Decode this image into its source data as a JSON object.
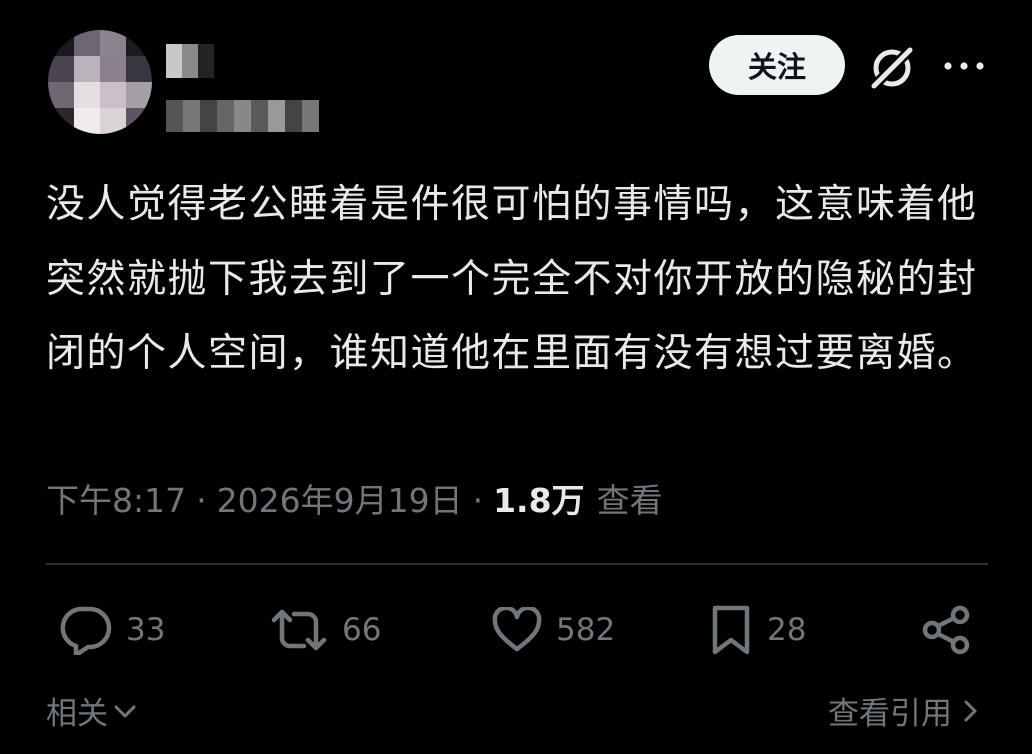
{
  "header": {
    "follow_label": "关注",
    "grok_icon": "grok-icon",
    "more_icon": "more-icon"
  },
  "post": {
    "text": "没人觉得老公睡着是件很可怕的事情吗，这意味着他突然就抛下我去到了一个完全不对你开放的隐秘的封闭的个人空间，谁知道他在里面有没有想过要离婚。",
    "time": "下午8:17",
    "separator": "·",
    "date": "2026年9月19日",
    "views_count": "1.8万",
    "views_label": "查看"
  },
  "actions": {
    "replies": "33",
    "reposts": "66",
    "likes": "582",
    "bookmarks": "28"
  },
  "footer": {
    "related_label": "相关",
    "quotes_label": "查看引用"
  },
  "colors": {
    "background": "#000000",
    "text": "#e7e9ea",
    "secondary": "#71767b",
    "divider": "#2f3336",
    "follow_bg": "#eff3f4"
  }
}
